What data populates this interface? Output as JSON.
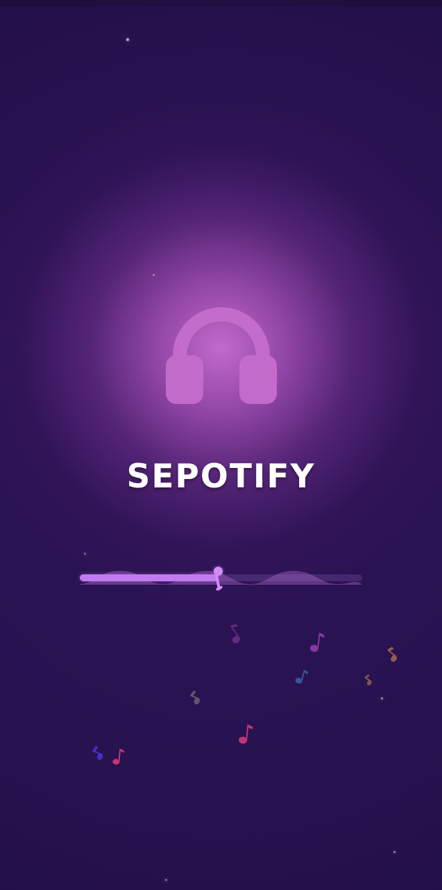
{
  "app": {
    "title": "SEPOTIFY"
  },
  "splash": {
    "progress": 0.49,
    "icon": "headphones-icon",
    "note_icon": "music-note-icon"
  },
  "colors": {
    "background": "#2a1352",
    "glow": "#c96ad5",
    "accent": "#c27af0",
    "icon": "#c56dcc",
    "note_pink": "#c93778",
    "note_blue": "#4b2fd2",
    "note_purple": "#8b3aa5",
    "note_brown": "#9a5f56",
    "note_indigo": "#3e5aa8",
    "note_gray": "#705d74"
  }
}
